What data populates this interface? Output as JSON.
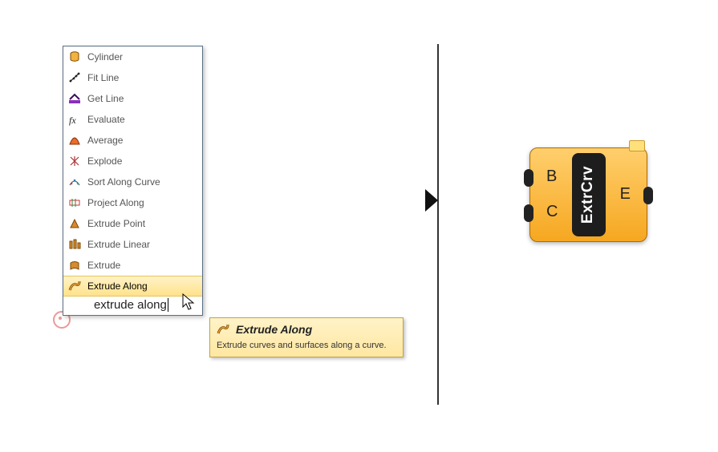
{
  "menu": {
    "items": [
      {
        "label": "Cylinder"
      },
      {
        "label": "Fit Line"
      },
      {
        "label": "Get Line"
      },
      {
        "label": "Evaluate"
      },
      {
        "label": "Average"
      },
      {
        "label": "Explode"
      },
      {
        "label": "Sort Along Curve"
      },
      {
        "label": "Project Along"
      },
      {
        "label": "Extrude Point"
      },
      {
        "label": "Extrude Linear"
      },
      {
        "label": "Extrude"
      },
      {
        "label": "Extrude Along"
      }
    ],
    "search_text": "extrude along"
  },
  "tooltip": {
    "title": "Extrude Along",
    "body": "Extrude curves and surfaces along a curve."
  },
  "component": {
    "name": "ExtrCrv",
    "inputs": [
      "B",
      "C"
    ],
    "outputs": [
      "E"
    ]
  }
}
